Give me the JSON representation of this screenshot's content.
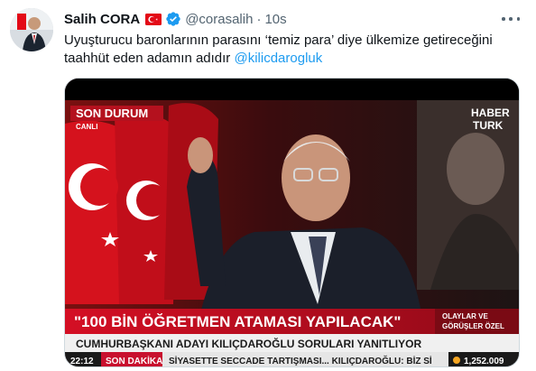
{
  "user": {
    "name": "Salih CORA",
    "handle": "@corasalih",
    "separator": "·",
    "time": "10s",
    "flag_icon": "turkey-flag-icon",
    "verified_icon": "verified-badge-icon"
  },
  "tweet": {
    "text_main": "Uyuşturucu baronlarının parasını ‘temiz para’ diye ülkemize getireceğini taahhüt eden adamın adıdır ",
    "mention": "@kilicdarogluk"
  },
  "video": {
    "tag_son_durum": "SON DURUM",
    "tag_canli": "CANLI",
    "channel_top": "HABER",
    "channel_bottom": "TURK",
    "headline": "\"100 BİN ÖĞRETMEN ATAMASI YAPILACAK\"",
    "side_label_top": "OLAYLAR VE",
    "side_label_bottom": "GÖRÜŞLER ÖZEL",
    "subline": "CUMHURBAŞKANI ADAYI KILIÇDAROĞLU SORULARI YANITLIYOR",
    "clock": "22:12",
    "ticker_label": "SON DAKİKA",
    "ticker_text": "SİYASETTE SECCADE TARTIŞMASI... KILIÇDAROĞLU: BİZ Sİ",
    "market_value": "1,252.009"
  },
  "colors": {
    "link": "#1d9bf0",
    "secondary": "#536471",
    "flag_red": "#e30a17",
    "broadcast_red": "#c8102e"
  }
}
